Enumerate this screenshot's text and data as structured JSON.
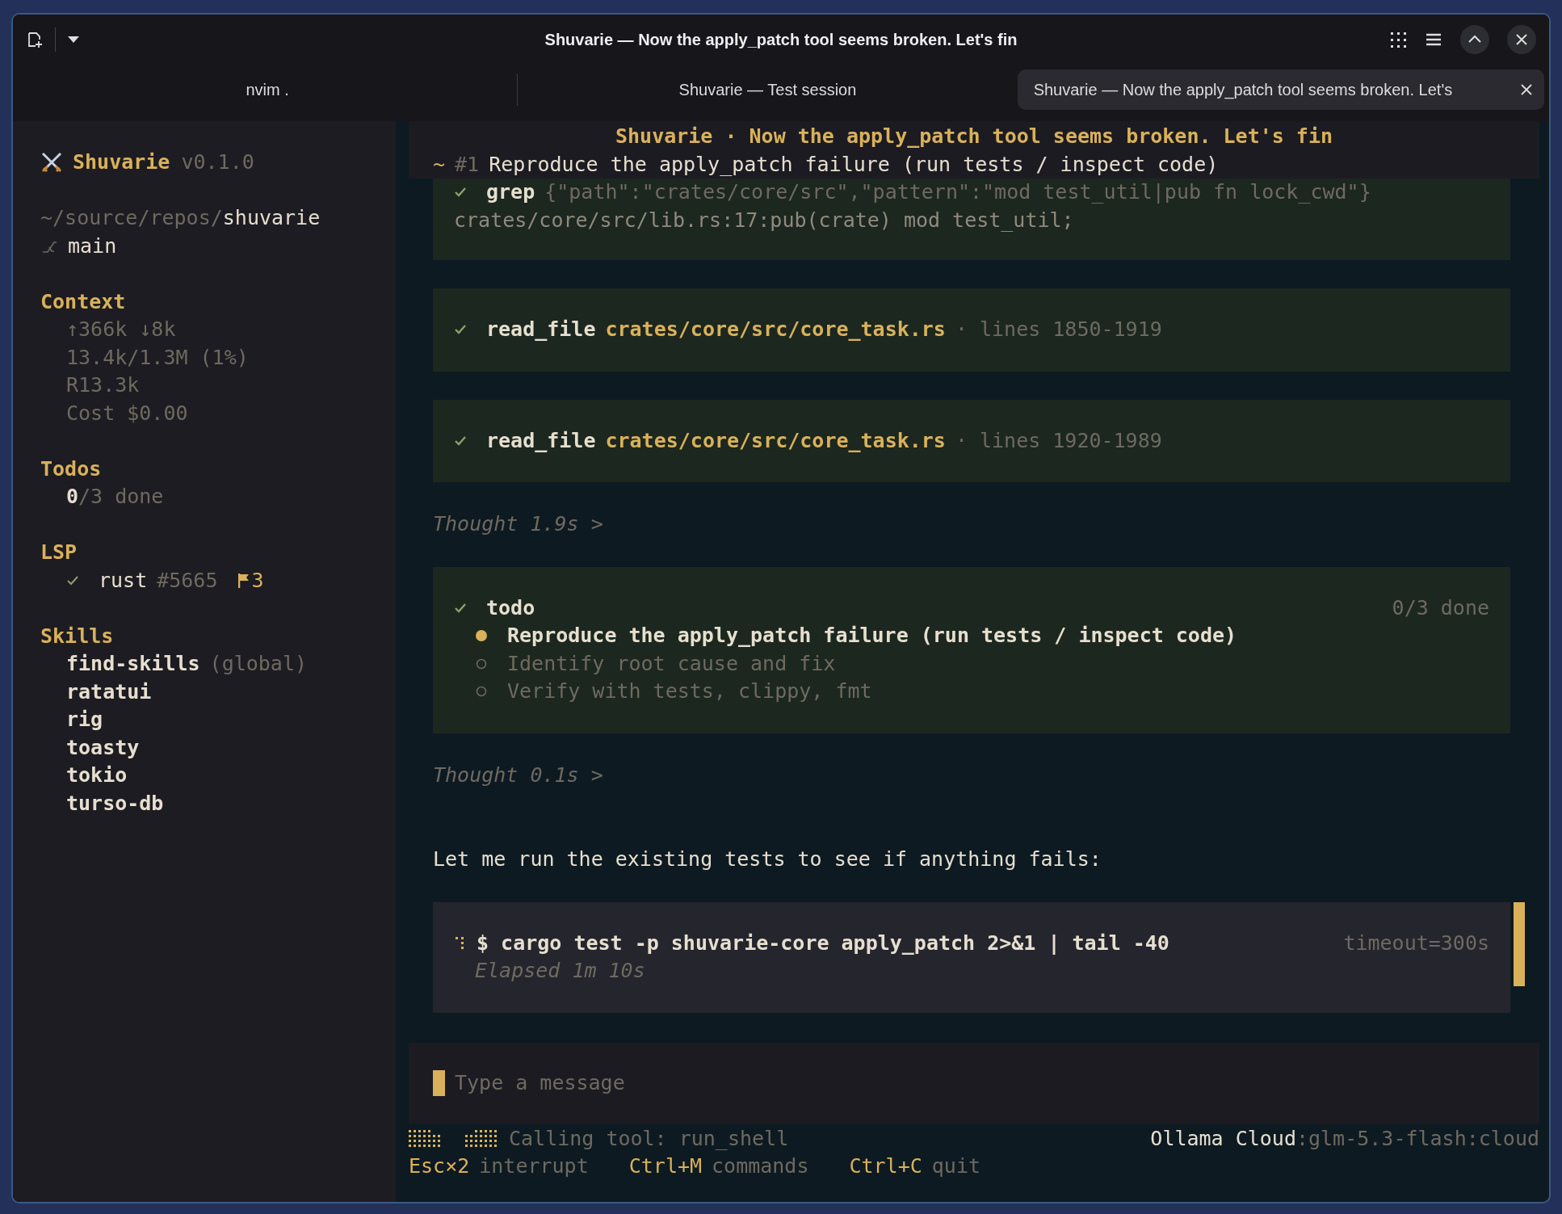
{
  "window": {
    "title": "Shuvarie — Now the apply_patch tool seems broken. Let's fin"
  },
  "tabs": [
    {
      "label": "nvim .",
      "selected": false
    },
    {
      "label": "Shuvarie — Test session",
      "selected": false
    },
    {
      "label": "Shuvarie — Now the apply_patch tool seems broken. Let's",
      "selected": true
    }
  ],
  "sidebar": {
    "app": {
      "name": "Shuvarie",
      "version": "v0.1.0"
    },
    "path": {
      "prefix": "~/source/repos/",
      "folder": "shuvarie"
    },
    "branch": "main",
    "context": {
      "title": "Context",
      "lines": [
        "↑366k ↓8k",
        "13.4k/1.3M (1%)",
        "R13.3k",
        "Cost $0.00"
      ]
    },
    "todos": {
      "title": "Todos",
      "summary": "**0**/3 done"
    },
    "lsp": {
      "title": "LSP",
      "servers": [
        {
          "connected": true,
          "name": "rust",
          "id": "#5665",
          "flags": "3"
        }
      ]
    },
    "skills": {
      "title": "Skills",
      "items": [
        {
          "name": "find-skills",
          "scope": "(global)"
        },
        {
          "name": "ratatui"
        },
        {
          "name": "rig"
        },
        {
          "name": "toasty"
        },
        {
          "name": "tokio"
        },
        {
          "name": "turso-db"
        }
      ]
    }
  },
  "session": {
    "title": "Shuvarie · Now the apply_patch tool seems broken. Let's fin",
    "current_todo": {
      "marker": "~",
      "number": "#1",
      "text": "Reproduce the apply_patch failure (run tests / inspect code)"
    }
  },
  "blocks": [
    {
      "kind": "tool",
      "done": true,
      "name": "grep",
      "args": "{\"path\":\"crates/core/src\",\"pattern\":\"mod test_util|pub fn lock_cwd\"}",
      "output": "crates/core/src/lib.rs:17:pub(crate) mod test_util;"
    },
    {
      "kind": "tool",
      "done": true,
      "name": "read_file",
      "path": "crates/core/src/core_task.rs",
      "detail": "· lines 1850-1919"
    },
    {
      "kind": "tool",
      "done": true,
      "name": "read_file",
      "path": "crates/core/src/core_task.rs",
      "detail": "· lines 1920-1989"
    },
    {
      "kind": "thought",
      "text": "Thought 1.9s >"
    },
    {
      "kind": "todo",
      "done": true,
      "name": "todo",
      "count": "0/3 done",
      "items": [
        {
          "text": "Reproduce the apply_patch failure (run tests / inspect code)",
          "in_progress": true
        },
        {
          "text": "Identify root cause and fix",
          "in_progress": false
        },
        {
          "text": "Verify with tests, clippy, fmt",
          "in_progress": false
        }
      ]
    },
    {
      "kind": "thought",
      "text": "Thought 0.1s >"
    },
    {
      "kind": "message",
      "text": "Let me run the existing tests to see if anything fails:"
    },
    {
      "kind": "shell",
      "running": true,
      "command": "$ cargo test -p shuvarie-core apply_patch 2>&1 | tail -40",
      "timeout": "timeout=300s",
      "elapsed": "Elapsed 1m 10s"
    }
  ],
  "input": {
    "placeholder": "Type a message"
  },
  "status_bar": {
    "activity": "Calling tool: run_shell",
    "provider": "Ollama Cloud",
    "model": ":glm-5.3-flash:cloud",
    "shortcuts": [
      {
        "key": "Esc×2",
        "label": "interrupt"
      },
      {
        "key": "Ctrl+M",
        "label": "commands"
      },
      {
        "key": "Ctrl+C",
        "label": "quit"
      }
    ]
  }
}
